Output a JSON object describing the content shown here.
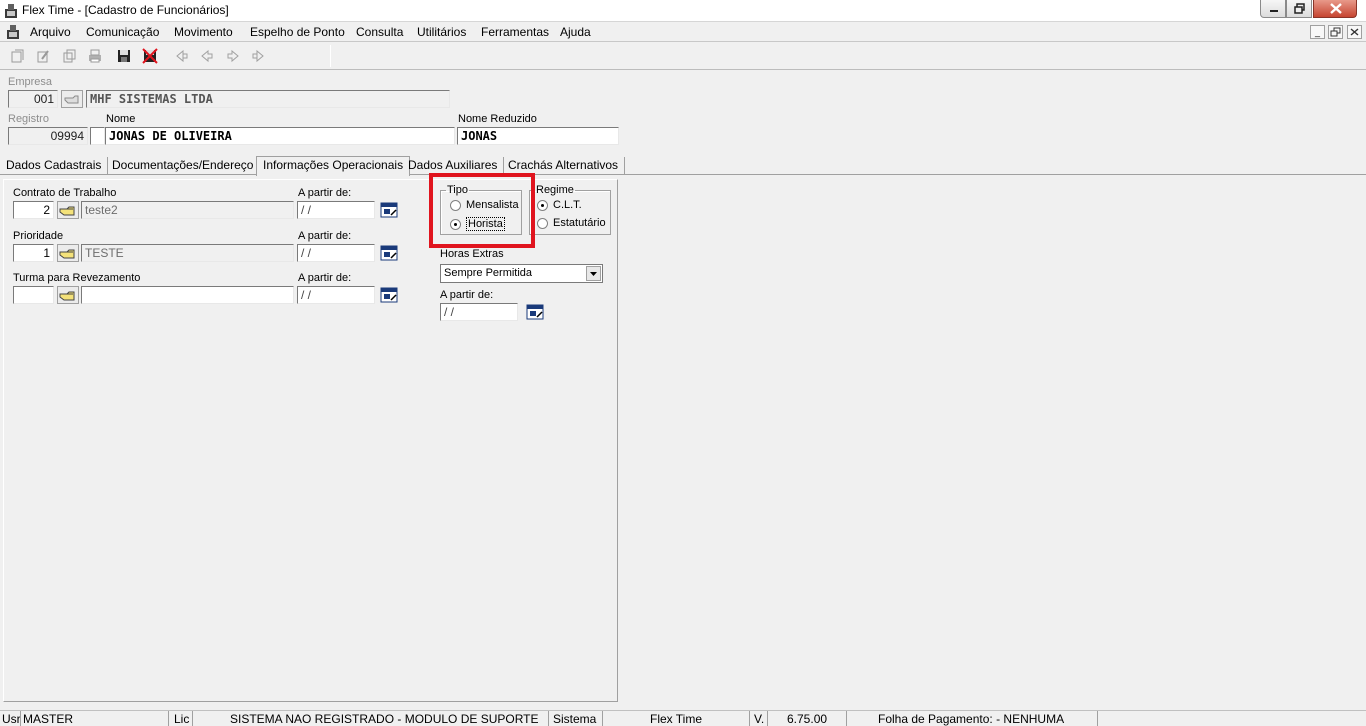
{
  "window": {
    "title": "Flex Time - [Cadastro de Funcionários]"
  },
  "menu": [
    {
      "label": "Arquivo"
    },
    {
      "label": "Comunicação"
    },
    {
      "label": "Movimento"
    },
    {
      "label": "Espelho de Ponto"
    },
    {
      "label": "Consulta"
    },
    {
      "label": "Utilitários"
    },
    {
      "label": "Ferramentas"
    },
    {
      "label": "Ajuda"
    }
  ],
  "header": {
    "empresa_label": "Empresa",
    "empresa_code": "001",
    "empresa_name": "MHF SISTEMAS LTDA",
    "registro_label": "Registro",
    "registro_value": "09994",
    "nome_label": "Nome",
    "nome_value": "JONAS DE OLIVEIRA",
    "nome_reduzido_label": "Nome Reduzido",
    "nome_reduzido_value": "JONAS"
  },
  "tabs": [
    {
      "label": "Dados Cadastrais"
    },
    {
      "label": "Documentações/Endereço"
    },
    {
      "label": "Informações Operacionais",
      "active": true
    },
    {
      "label": "Dados Auxiliares"
    },
    {
      "label": "Crachás Alternativos"
    }
  ],
  "form": {
    "contrato_label": "Contrato de Trabalho",
    "contrato_code": "2",
    "contrato_desc": "teste2",
    "contrato_date_label": "A partir de:",
    "contrato_date": " /  /",
    "prioridade_label": "Prioridade",
    "prioridade_code": "1",
    "prioridade_desc": "TESTE",
    "prioridade_date_label": "A partir de:",
    "prioridade_date": " /  /",
    "turma_label": "Turma para Revezamento",
    "turma_code": "",
    "turma_desc": "",
    "turma_date_label": "A partir de:",
    "turma_date": " /  /",
    "tipo_label": "Tipo",
    "tipo_options": [
      "Mensalista",
      "Horista"
    ],
    "tipo_selected": "Horista",
    "regime_label": "Regime",
    "regime_options": [
      "C.L.T.",
      "Estatutário"
    ],
    "regime_selected": "C.L.T.",
    "horas_extras_label": "Horas Extras",
    "horas_extras_value": "Sempre Permitida",
    "horas_date_label": "A partir de:",
    "horas_date": " /  /"
  },
  "status": {
    "usr_label": "Usr",
    "usr_value": "MASTER",
    "lic_label": "Lic",
    "lic_value": "SISTEMA NAO REGISTRADO - MODULO DE SUPORTE",
    "sistema_label": "Sistema",
    "sistema_value": "Flex Time",
    "v_label": "V.",
    "v_value": "6.75.00",
    "folha": "Folha de Pagamento:  - NENHUMA"
  },
  "colors": {
    "highlight": "#e0141e",
    "background": "#f0f0f0"
  }
}
